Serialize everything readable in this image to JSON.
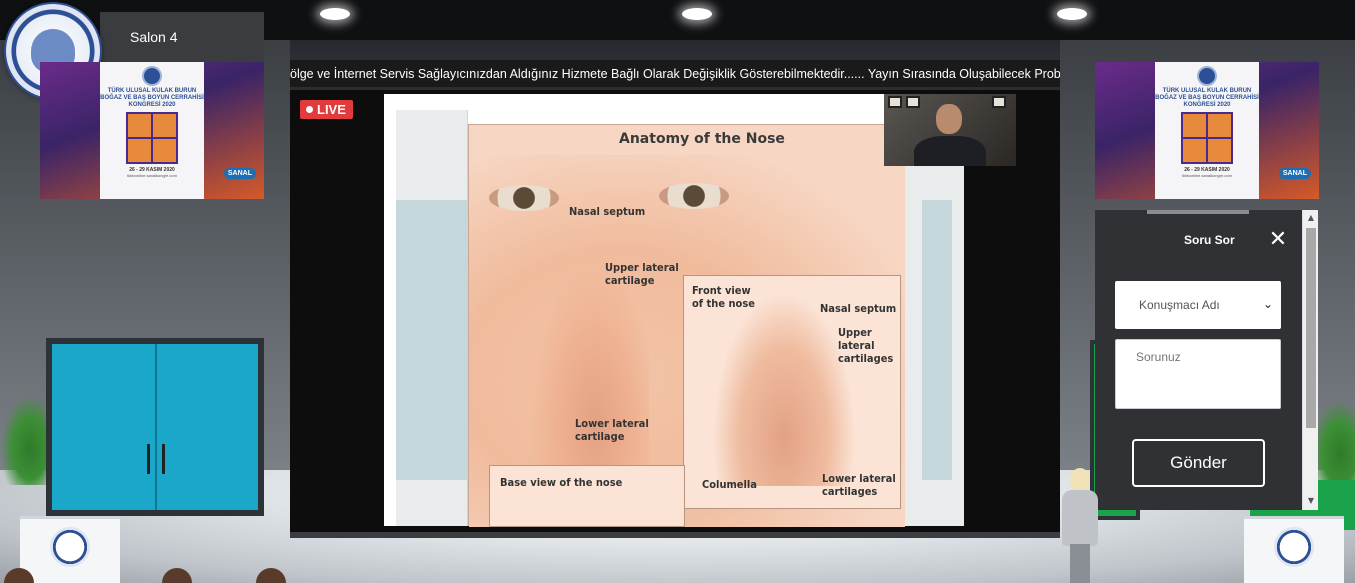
{
  "hall": {
    "salon_label": "Salon 4"
  },
  "posters": {
    "title": "TÜRK ULUSAL KULAK BURUN\nBOĞAZ VE BAŞ BOYUN CERRAHİSİ\nKONGRESİ 2020",
    "date": "26 - 29 KASIM 2020",
    "site": "tkbbonline.sanalkongre.com",
    "badge": "SANAL"
  },
  "stream": {
    "ticker_text": "ölge ve İnternet Servis Sağlayıcınızdan Aldığınız Hizmete Bağlı Olarak Değişiklik Gösterebilmektedir...... Yayın Sırasında Oluşabilecek Problemlerde Lütfe",
    "live_label": "LIVE"
  },
  "slide": {
    "title": "Anatomy of the Nose",
    "labels": {
      "nasal_septum": "Nasal septum",
      "upper_lateral": "Upper lateral\ncartilage",
      "lower_lateral": "Lower lateral\ncartilage",
      "front_view": "Front view\nof the nose",
      "front_septum": "Nasal septum",
      "front_upper": "Upper\nlateral\ncartilages",
      "columella": "Columella",
      "front_lower": "Lower lateral\ncartilages",
      "base_view": "Base view of the nose"
    }
  },
  "qa": {
    "title": "Soru Sor",
    "speaker_select": "Konuşmacı Adı",
    "question_placeholder": "Sorunuz",
    "send_label": "Gönder"
  },
  "icons": {
    "close": "close-icon",
    "chevron": "chevron-down-icon",
    "live_dot": "live-dot-icon"
  },
  "colors": {
    "live": "#e23b3b",
    "panel": "#2f3135",
    "door": "#1aa7c9"
  }
}
